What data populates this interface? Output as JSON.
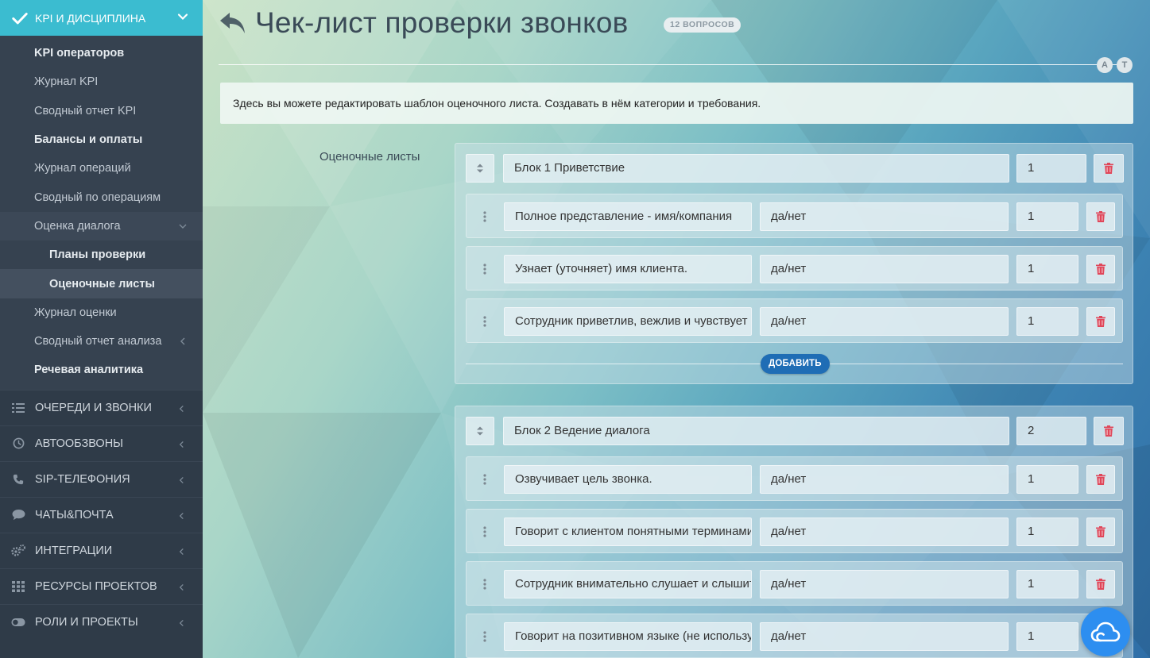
{
  "sidebar": {
    "active_section": "KPI И ДИСЦИПЛИНА",
    "links": [
      {
        "label": "KPI операторов",
        "style": "bold"
      },
      {
        "label": "Журнал KPI",
        "style": "normal"
      },
      {
        "label": "Сводный отчет KPI",
        "style": "normal"
      },
      {
        "label": "Балансы и оплаты",
        "style": "bold"
      },
      {
        "label": "Журнал операций",
        "style": "normal"
      },
      {
        "label": "Сводный по операциям",
        "style": "normal"
      },
      {
        "label": "Оценка диалога",
        "style": "expanded"
      },
      {
        "label": "Планы проверки",
        "style": "deep"
      },
      {
        "label": "Оценочные листы",
        "style": "deep-current"
      },
      {
        "label": "Журнал оценки",
        "style": "normal"
      },
      {
        "label": "Сводный отчет анализа",
        "style": "collapsed"
      },
      {
        "label": "Речевая аналитика",
        "style": "bold"
      }
    ],
    "sections": [
      {
        "label": "ОЧЕРЕДИ И ЗВОНКИ",
        "icon": "list-icon"
      },
      {
        "label": "АВТООБЗВОНЫ",
        "icon": "clock-icon"
      },
      {
        "label": "SIP-ТЕЛЕФОНИЯ",
        "icon": "phone-icon"
      },
      {
        "label": "ЧАТЫ&ПОЧТА",
        "icon": "chat-icon"
      },
      {
        "label": "ИНТЕГРАЦИИ",
        "icon": "gears-icon"
      },
      {
        "label": "РЕСУРСЫ ПРОЕКТОВ",
        "icon": "grid-icon"
      },
      {
        "label": "РОЛИ И ПРОЕКТЫ",
        "icon": "toggle-icon"
      }
    ]
  },
  "header": {
    "title": "Чек-лист проверки звонков",
    "badge": "12 ВОПРОСОВ",
    "circle_a": "A",
    "circle_t": "T"
  },
  "info_text": "Здесь вы можете редактировать шаблон оценочного листа. Создавать в нём категории и требования.",
  "side_label": "Оценочные листы",
  "blocks": [
    {
      "name": "Блок 1 Приветствие",
      "order": "1",
      "add_label": "ДОБАВИТЬ",
      "items": [
        {
          "text": "Полное представление - имя/компания",
          "type": "да/нет",
          "weight": "1"
        },
        {
          "text": "Узнает (уточняет) имя клиента.",
          "type": "да/нет",
          "weight": "1"
        },
        {
          "text": "Сотрудник приветлив, вежлив и чувствует",
          "type": "да/нет",
          "weight": "1"
        }
      ]
    },
    {
      "name": "Блок 2 Ведение диалога",
      "order": "2",
      "items": [
        {
          "text": "Озвучивает цель звонка.",
          "type": "да/нет",
          "weight": "1"
        },
        {
          "text": "Говорит с клиентом понятными терминами",
          "type": "да/нет",
          "weight": "1"
        },
        {
          "text": "Сотрудник внимательно слушает и слышит",
          "type": "да/нет",
          "weight": "1"
        },
        {
          "text": "Говорит на позитивном языке (не использует",
          "type": "да/нет",
          "weight": "1"
        }
      ]
    }
  ],
  "colors": {
    "sidebar_bg": "#2f3b48",
    "sidebar_active": "#3bbcd0",
    "add_button": "#1f6db5",
    "trash": "#e0475a",
    "cloud_button": "#2d8ef0"
  }
}
